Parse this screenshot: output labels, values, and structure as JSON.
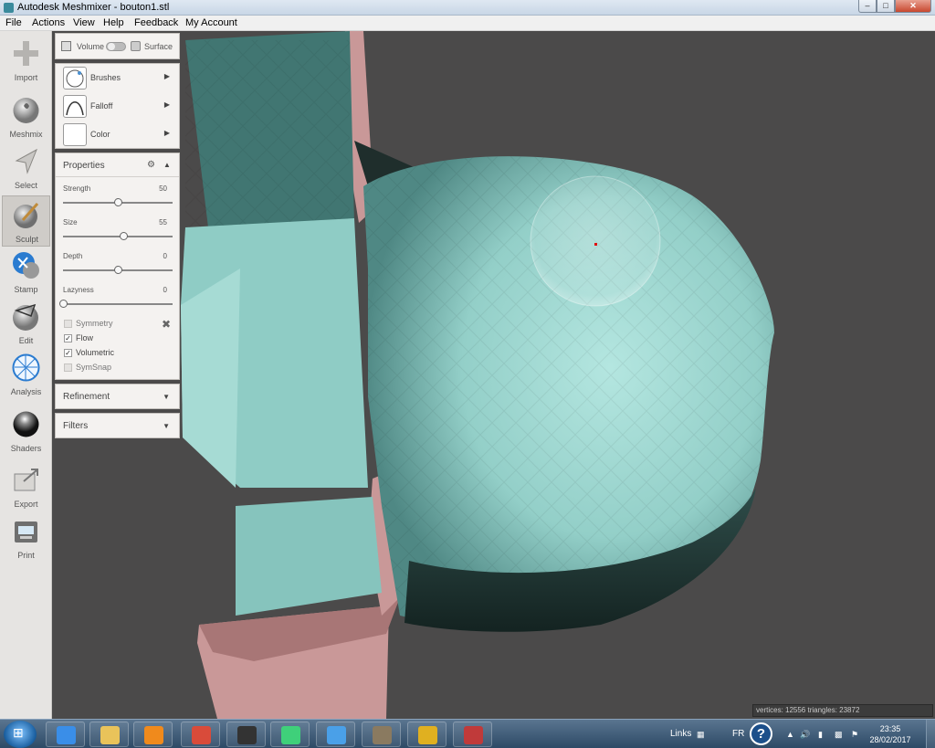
{
  "window": {
    "title": "Autodesk Meshmixer - bouton1.stl"
  },
  "menu": [
    "File",
    "Actions",
    "View",
    "Help",
    "Feedback",
    "My Account"
  ],
  "toolbar": [
    {
      "label": "Import",
      "icon": "plus-icon"
    },
    {
      "label": "Meshmix",
      "icon": "meshmix-bunny-icon"
    },
    {
      "label": "Select",
      "icon": "select-arrow-icon"
    },
    {
      "label": "Sculpt",
      "icon": "sculpt-brush-icon",
      "active": true
    },
    {
      "label": "Stamp",
      "icon": "stamp-icon"
    },
    {
      "label": "Edit",
      "icon": "edit-icon"
    },
    {
      "label": "Analysis",
      "icon": "analysis-icon"
    },
    {
      "label": "Shaders",
      "icon": "shaders-sphere-icon"
    },
    {
      "label": "Export",
      "icon": "export-icon"
    },
    {
      "label": "Print",
      "icon": "print-icon"
    }
  ],
  "panel": {
    "mode": {
      "volume_label": "Volume",
      "surface_label": "Surface"
    },
    "brushes": [
      {
        "label": "Brushes"
      },
      {
        "label": "Falloff"
      },
      {
        "label": "Color"
      }
    ],
    "properties": {
      "title": "Properties",
      "params": [
        {
          "name": "Strength",
          "value": 50,
          "fraction": 0.5
        },
        {
          "name": "Size",
          "value": 55,
          "fraction": 0.55
        },
        {
          "name": "Depth",
          "value": 0,
          "fraction": 0.5
        },
        {
          "name": "Lazyness",
          "value": 0,
          "fraction": 0.0
        }
      ],
      "checkboxes": [
        {
          "label": "Symmetry",
          "checked": false,
          "enabled": false
        },
        {
          "label": "Flow",
          "checked": true,
          "enabled": true
        },
        {
          "label": "Volumetric",
          "checked": true,
          "enabled": true
        },
        {
          "label": "SymSnap",
          "checked": false,
          "enabled": false
        }
      ]
    },
    "refinement": {
      "title": "Refinement"
    },
    "filters": {
      "title": "Filters"
    }
  },
  "viewport": {
    "stats": "vertices: 12556 triangles: 23872",
    "mesh_color": "#9fd8d2",
    "base_color": "#d3a0a0",
    "background": "#4b4a4a"
  },
  "taskbar": {
    "links_label": "Links",
    "language": "FR",
    "help_glyph": "?",
    "time": "23:35",
    "date": "28/02/2017",
    "apps": [
      {
        "name": "internet-explorer-icon",
        "color": "#3a8ee8"
      },
      {
        "name": "file-explorer-icon",
        "color": "#e9c35a"
      },
      {
        "name": "media-player-icon",
        "color": "#f08a1c"
      },
      {
        "name": "chrome-icon",
        "color": "#d94b3a"
      },
      {
        "name": "inkscape-icon",
        "color": "#333333"
      },
      {
        "name": "atom-icon",
        "color": "#3fd07a"
      },
      {
        "name": "colored-squares-icon",
        "color": "#4aa0e8"
      },
      {
        "name": "gimp-icon",
        "color": "#8a7a60"
      },
      {
        "name": "blender-ball-icon",
        "color": "#e0b020"
      },
      {
        "name": "meshmixer-icon",
        "color": "#c03a3a"
      }
    ]
  }
}
